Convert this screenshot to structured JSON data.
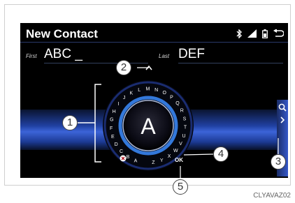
{
  "screen": {
    "title": "New Contact",
    "status_icons": [
      "bluetooth-icon",
      "signal-icon",
      "battery-icon",
      "back-icon"
    ],
    "first_field": {
      "label": "First",
      "value": "ABC _"
    },
    "last_field": {
      "label": "Last",
      "value": "DEF"
    },
    "center_letter": "A",
    "ok_label": "OK",
    "letters": [
      "A",
      "B",
      "C",
      "D",
      "E",
      "F",
      "G",
      "H",
      "I",
      "J",
      "K",
      "L",
      "M",
      "N",
      "O",
      "P",
      "Q",
      "R",
      "S",
      "T",
      "U",
      "V",
      "W",
      "X",
      "Y",
      "Z"
    ],
    "side_buttons": [
      "search-icon",
      "chevron-right-icon"
    ]
  },
  "callouts": [
    "1",
    "2",
    "3",
    "4",
    "5"
  ],
  "caption": "CLYAVAZ02"
}
